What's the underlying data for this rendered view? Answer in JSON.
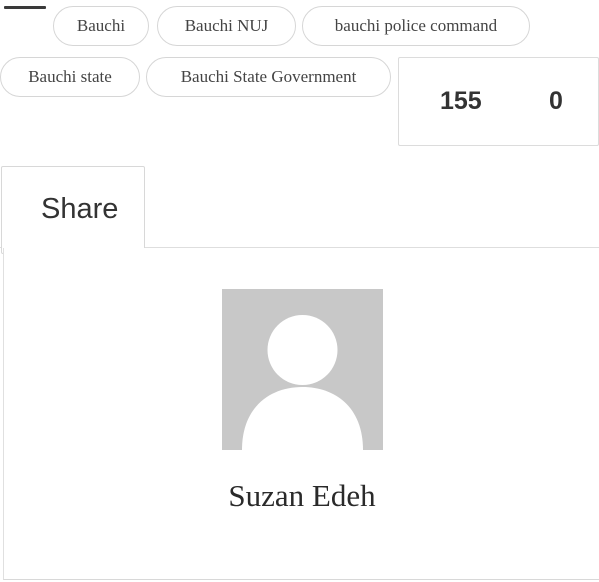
{
  "tags": [
    {
      "label": "Bauchi"
    },
    {
      "label": "Bauchi NUJ"
    },
    {
      "label": "bauchi police command"
    },
    {
      "label": "Bauchi state"
    },
    {
      "label": "Bauchi State Government"
    }
  ],
  "stats": {
    "first_count": "155",
    "second_count": "0"
  },
  "share": {
    "label": "Share"
  },
  "author": {
    "name": "Suzan Edeh"
  },
  "colors": {
    "tag_border": "#d6d6d6",
    "avatar_bg": "#c8c8c8",
    "avatar_silhouette": "#ffffff"
  },
  "icons": {
    "avatar": "default-user-avatar-icon"
  }
}
